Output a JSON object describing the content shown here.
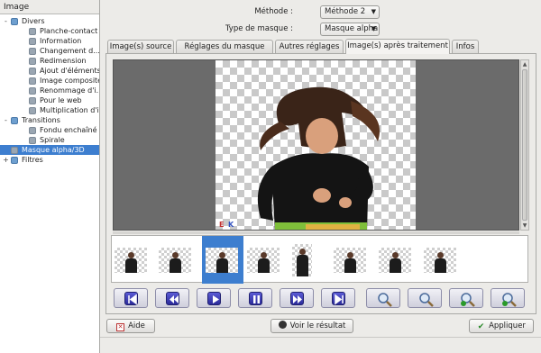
{
  "sidebar": {
    "header": "Image",
    "tree": [
      {
        "label": "Divers",
        "level": 0,
        "expander": "-",
        "category": true
      },
      {
        "label": "Planche-contact",
        "level": 1
      },
      {
        "label": "Information",
        "level": 1
      },
      {
        "label": "Changement d...",
        "level": 1
      },
      {
        "label": "Redimension",
        "level": 1
      },
      {
        "label": "Ajout d'éléments",
        "level": 1
      },
      {
        "label": "Image composite",
        "level": 1
      },
      {
        "label": "Renommage d'i...",
        "level": 1
      },
      {
        "label": "Pour le web",
        "level": 1
      },
      {
        "label": "Multiplication d'i...",
        "level": 1
      },
      {
        "label": "Transitions",
        "level": 0,
        "expander": "-",
        "category": true
      },
      {
        "label": "Fondu enchaîné",
        "level": 1
      },
      {
        "label": "Spirale",
        "level": 1
      },
      {
        "label": "Masque alpha/3D",
        "level": 0,
        "selected": true
      },
      {
        "label": "Filtres",
        "level": 0,
        "expander": "+",
        "category": true
      }
    ]
  },
  "methode": {
    "label": "Méthode :",
    "value": "Méthode 2"
  },
  "masque": {
    "label": "Type de masque :",
    "value": "Masque alpha"
  },
  "tabs": [
    {
      "label": "Image(s) source"
    },
    {
      "label": "Réglages du masque"
    },
    {
      "label": "Autres réglages"
    },
    {
      "label": "Image(s) après traitement",
      "active": true
    },
    {
      "label": "Infos"
    }
  ],
  "preview": {
    "corner_e": "E",
    "corner_k": "K"
  },
  "thumbnails": {
    "count": 8,
    "selected_index": 2
  },
  "controls": [
    {
      "name": "first-button",
      "icon": "first-icon"
    },
    {
      "name": "previous-button",
      "icon": "rewind-icon"
    },
    {
      "name": "play-button",
      "icon": "play-icon"
    },
    {
      "name": "pause-button",
      "icon": "pause-icon"
    },
    {
      "name": "next-button",
      "icon": "fast-forward-icon"
    },
    {
      "name": "last-button",
      "icon": "last-icon"
    },
    {
      "name": "zoom-button",
      "icon": "magnifier-icon"
    },
    {
      "name": "zoom-fit-button",
      "icon": "magnifier-icon"
    },
    {
      "name": "zoom-in-button",
      "icon": "zoom-in-icon"
    },
    {
      "name": "zoom-out-button",
      "icon": "zoom-out-icon"
    }
  ],
  "buttons": {
    "aide": "Aide",
    "voir": "Voir le résultat",
    "appliquer": "Appliquer"
  },
  "colors": {
    "selection": "#3d7ecf",
    "control_icon": "#3a3ab4"
  }
}
